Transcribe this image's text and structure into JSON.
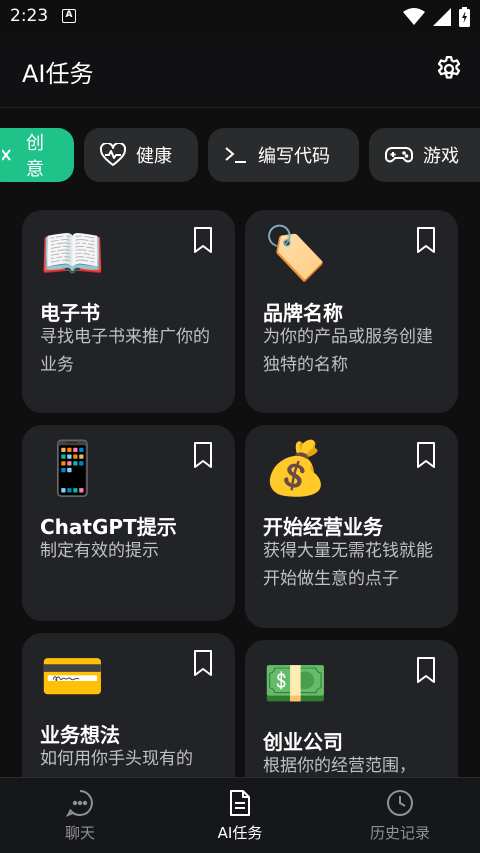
{
  "status_bar": {
    "time": "2:23",
    "notification_letter": "A"
  },
  "app_bar": {
    "title": "AI任务",
    "settings_icon": "gear-icon"
  },
  "chips": [
    {
      "label": "创意",
      "icon": "sparkle-icon",
      "active": true
    },
    {
      "label": "健康",
      "icon": "heart-pulse-icon",
      "active": false
    },
    {
      "label": "编写代码",
      "icon": "terminal-icon",
      "active": false
    },
    {
      "label": "游戏",
      "icon": "gamepad-icon",
      "active": false
    }
  ],
  "cards": [
    {
      "emoji": "📖",
      "icon": "open-book-icon",
      "title": "电子书",
      "desc": "寻找电子书来推广你的业务"
    },
    {
      "emoji": "🏷️",
      "icon": "label-tag-icon",
      "title": "品牌名称",
      "desc": "为你的产品或服务创建独特的名称"
    },
    {
      "emoji": "📱",
      "icon": "mobile-phone-icon",
      "title": "ChatGPT提示",
      "desc": "制定有效的提示"
    },
    {
      "emoji": "💰",
      "icon": "money-bag-icon",
      "title": "开始经营业务",
      "desc": "获得大量无需花钱就能开始做生意的点子"
    },
    {
      "emoji": "💳",
      "icon": "credit-card-icon",
      "title": "业务想法",
      "desc": "如何用你手头现有的"
    },
    {
      "emoji": "💵",
      "icon": "dollar-bill-icon",
      "title": "创业公司",
      "desc": "根据你的经营范围，"
    }
  ],
  "bottom_nav": [
    {
      "label": "聊天",
      "icon": "chat-bubble-icon",
      "active": false
    },
    {
      "label": "AI任务",
      "icon": "document-icon",
      "active": true
    },
    {
      "label": "历史记录",
      "icon": "clock-icon",
      "active": false
    }
  ],
  "colors": {
    "accent": "#1fc38a",
    "card_bg": "#222326",
    "background": "#0f0f10"
  }
}
